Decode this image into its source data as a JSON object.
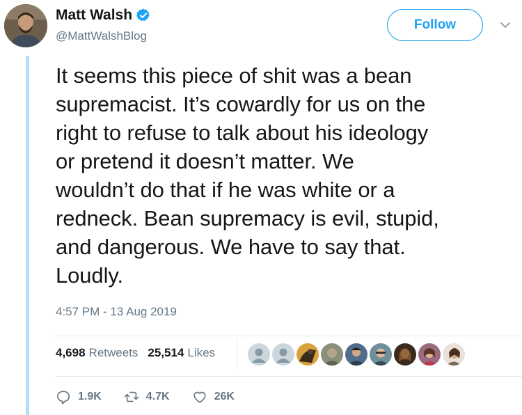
{
  "author": {
    "display_name": "Matt Walsh",
    "handle": "@MattWalshBlog",
    "verified": true
  },
  "follow_label": "Follow",
  "tweet": {
    "text": "It seems this piece of shit was a bean\nsupremacist. It’s cowardly for us on the\nright to refuse to talk about his ideology\nor pretend it doesn’t matter. We\nwouldn’t do that if he was white or a\nredneck. Bean supremacy is evil, stupid,\nand dangerous. We have to say that.\nLoudly.",
    "timestamp": "4:57 PM - 13 Aug 2019"
  },
  "stats": {
    "retweets_count": "4,698",
    "retweets_label": "Retweets",
    "likes_count": "25,514",
    "likes_label": "Likes"
  },
  "likers": [
    "default-avatar",
    "default-avatar",
    "avatar",
    "avatar",
    "avatar",
    "avatar",
    "avatar",
    "avatar",
    "avatar"
  ],
  "actions": {
    "replies": "1.9K",
    "retweets": "4.7K",
    "likes": "26K"
  },
  "colors": {
    "brand_blue": "#1da1f2",
    "text": "#14171a",
    "secondary": "#657786",
    "thread_line": "#b5dcf4"
  }
}
